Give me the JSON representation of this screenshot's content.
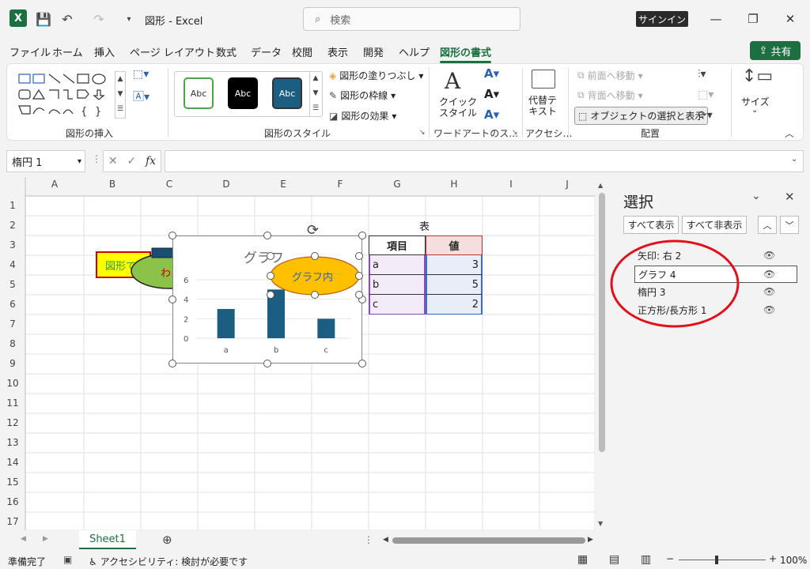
{
  "window": {
    "title": "図形  -  Excel",
    "search_placeholder": "検索",
    "signin": "サインイン",
    "share": "共有"
  },
  "tabs": [
    "ファイル",
    "ホーム",
    "挿入",
    "ページ レイアウト",
    "数式",
    "データ",
    "校閲",
    "表示",
    "開発",
    "ヘルプ",
    "図形の書式"
  ],
  "active_tab": "図形の書式",
  "ribbon": {
    "groups": [
      "図形の挿入",
      "図形のスタイル",
      "ワードアートのス…",
      "アクセシ…",
      "配置"
    ],
    "style_swatch_text": "Abc",
    "fill": "図形の塗りつぶし",
    "outline": "図形の枠線",
    "effects": "図形の効果",
    "quick_style": "クイック\nスタイル",
    "alt_text": "代替テ\nキスト",
    "bring_forward": "前面へ移動",
    "send_backward": "背面へ移動",
    "selection_pane": "オブジェクトの選択と表示",
    "size": "サイズ"
  },
  "namebox": "楕円 1",
  "fx": "fx",
  "columns": [
    "A",
    "B",
    "C",
    "D",
    "E",
    "F",
    "G",
    "H",
    "I",
    "J"
  ],
  "rows": [
    "1",
    "2",
    "3",
    "4",
    "5",
    "6",
    "7",
    "8",
    "9",
    "10",
    "11",
    "12",
    "13",
    "14",
    "15",
    "16",
    "17"
  ],
  "shapes": {
    "rect_text": "図形で",
    "ellipse_text": "わ",
    "orange_ellipse_text": "グラフ内"
  },
  "table": {
    "caption": "表",
    "headers": [
      "項目",
      "値"
    ],
    "rows": [
      [
        "a",
        "3"
      ],
      [
        "b",
        "5"
      ],
      [
        "c",
        "2"
      ]
    ]
  },
  "chart_data": {
    "type": "bar",
    "title": "グラフ",
    "categories": [
      "a",
      "b",
      "c"
    ],
    "values": [
      3,
      5,
      2
    ],
    "ylim": [
      0,
      6
    ],
    "yticks": [
      "0",
      "2",
      "4",
      "6"
    ],
    "color": "#1b5e82"
  },
  "pane": {
    "title": "選択",
    "show_all": "すべて表示",
    "hide_all": "すべて非表示",
    "items": [
      "矢印: 右 2",
      "グラフ 4",
      "楕円 3",
      "正方形/長方形 1"
    ],
    "selected": "グラフ 4"
  },
  "sheet_tab": "Sheet1",
  "status": {
    "ready": "準備完了",
    "accessibility": "アクセシビリティ: 検討が必要です",
    "zoom": "100%"
  }
}
